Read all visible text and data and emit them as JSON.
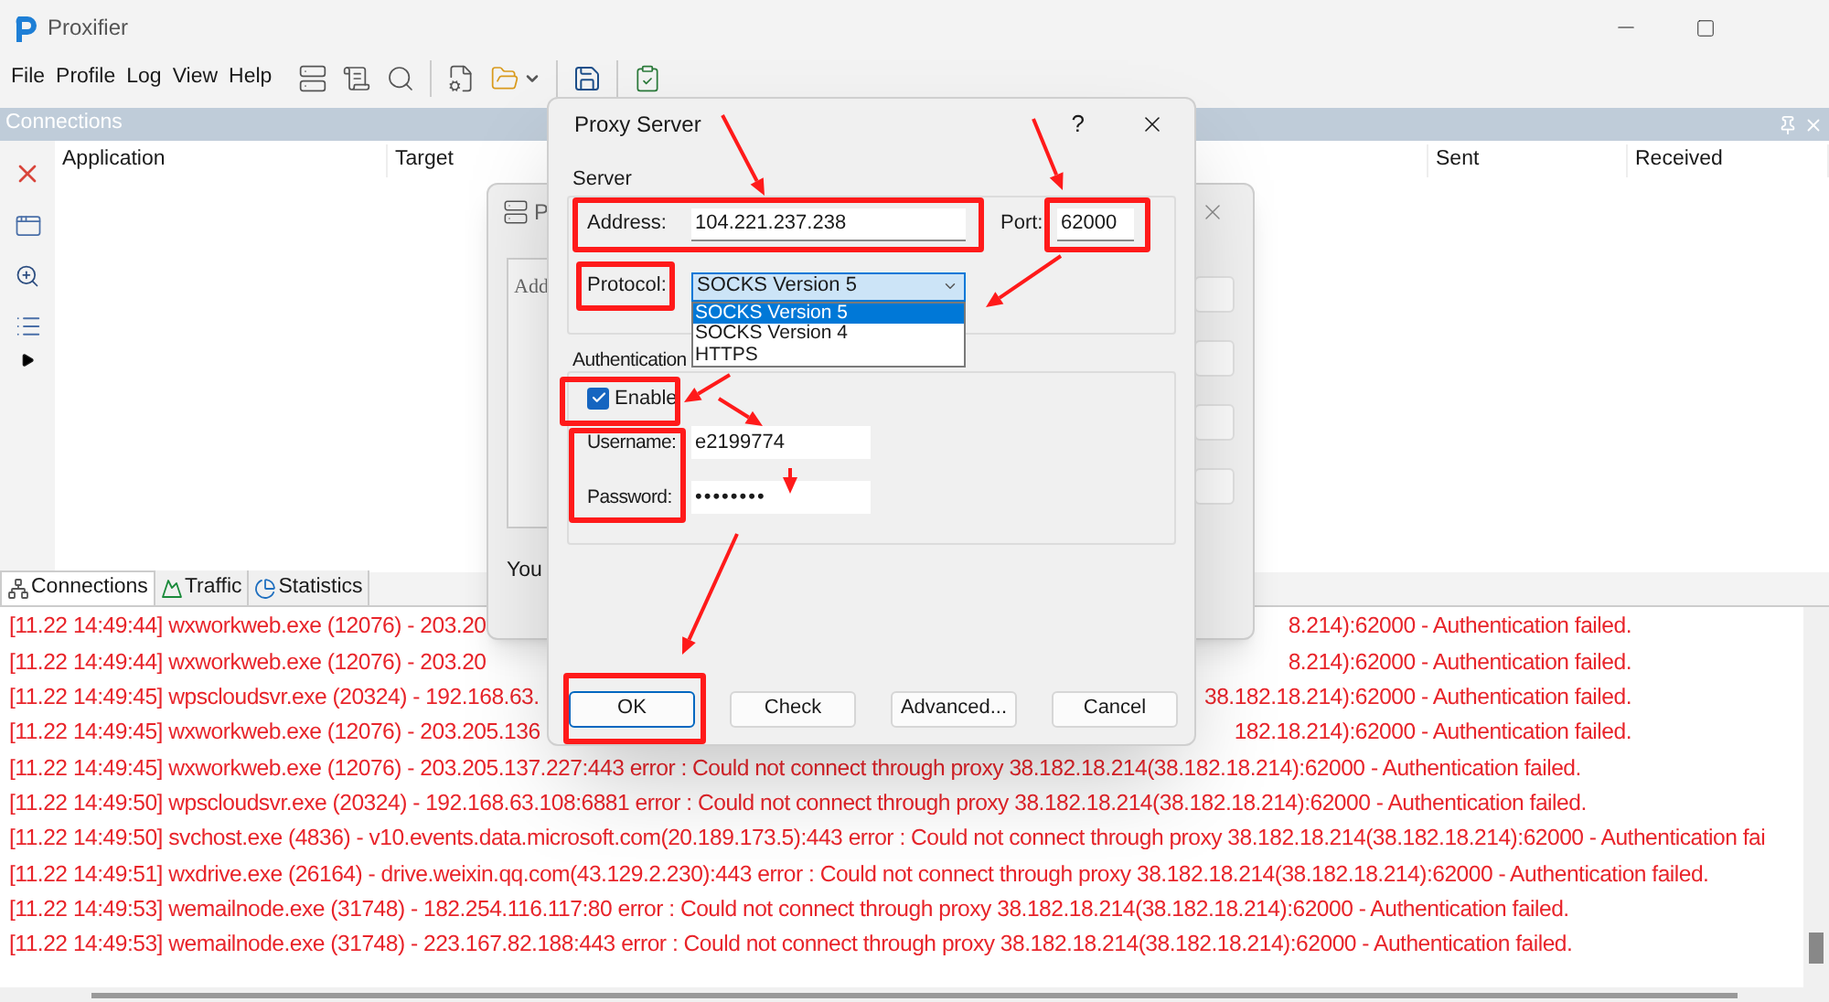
{
  "window": {
    "title": "Proxifier"
  },
  "menu": [
    "File",
    "Profile",
    "Log",
    "View",
    "Help"
  ],
  "connections_panel": {
    "title": "Connections",
    "columns": [
      "Application",
      "Target",
      "Sent",
      "Received"
    ]
  },
  "bottom_tabs": [
    {
      "label": "Connections",
      "selected": true
    },
    {
      "label": "Traffic",
      "selected": false
    },
    {
      "label": "Statistics",
      "selected": false
    }
  ],
  "log": [
    {
      "left": "[11.22 14:49:44] wxworkweb.exe (12076) - 203.20",
      "right": "8.214):62000 - Authentication failed."
    },
    {
      "left": "[11.22 14:49:44] wxworkweb.exe (12076) - 203.20",
      "right": "8.214):62000 - Authentication failed."
    },
    {
      "left": "[11.22 14:49:45] wpscloudsvr.exe (20324) - 192.168.63.",
      "right": "38.182.18.214):62000 - Authentication failed."
    },
    {
      "left": "[11.22 14:49:45] wxworkweb.exe (12076) - 203.205.136",
      "right": "182.18.214):62000 - Authentication failed."
    },
    {
      "text": "[11.22 14:49:45] wxworkweb.exe (12076) - 203.205.137.227:443 error : Could not connect through proxy 38.182.18.214(38.182.18.214):62000 - Authentication failed."
    },
    {
      "text": "[11.22 14:49:50] wpscloudsvr.exe (20324) - 192.168.63.108:6881 error : Could not connect through proxy 38.182.18.214(38.182.18.214):62000 - Authentication failed."
    },
    {
      "text": "[11.22 14:49:50] svchost.exe (4836) - v10.events.data.microsoft.com(20.189.173.5):443 error : Could not connect through proxy 38.182.18.214(38.182.18.214):62000 - Authentication fai"
    },
    {
      "text": "[11.22 14:49:51] wxdrive.exe (26164) - drive.weixin.qq.com(43.129.2.230):443 error : Could not connect through proxy 38.182.18.214(38.182.18.214):62000 - Authentication failed."
    },
    {
      "text": "[11.22 14:49:53] wemailnode.exe (31748) - 182.254.116.117:80 error : Could not connect through proxy 38.182.18.214(38.182.18.214):62000 - Authentication failed."
    },
    {
      "text": "[11.22 14:49:53] wemailnode.exe (31748) - 223.167.82.188:443 error : Could not connect through proxy 38.182.18.214(38.182.18.214):62000 - Authentication failed."
    }
  ],
  "proxies_dialog": {
    "title": "P",
    "list_text": "Add",
    "note": "You"
  },
  "proxy_server_dialog": {
    "title": "Proxy Server",
    "help": "?",
    "server_label": "Server",
    "address_label": "Address:",
    "address": "104.221.237.238",
    "port_label": "Port:",
    "port": "62000",
    "protocol_label": "Protocol:",
    "protocol": "SOCKS Version 5",
    "protocol_options": [
      {
        "label": "SOCKS Version 5",
        "selected": true
      },
      {
        "label": "SOCKS Version 4",
        "selected": false
      },
      {
        "label": "HTTPS",
        "selected": false
      }
    ],
    "auth_label": "Authentication",
    "enable": {
      "label": "Enable",
      "checked": true
    },
    "username_label": "Username:",
    "username": "e2199774",
    "password_label": "Password:",
    "password": "••••••••",
    "buttons": [
      {
        "label": "OK",
        "default": true
      },
      {
        "label": "Check",
        "default": false
      },
      {
        "label": "Advanced...",
        "default": false
      },
      {
        "label": "Cancel",
        "default": false
      }
    ]
  }
}
